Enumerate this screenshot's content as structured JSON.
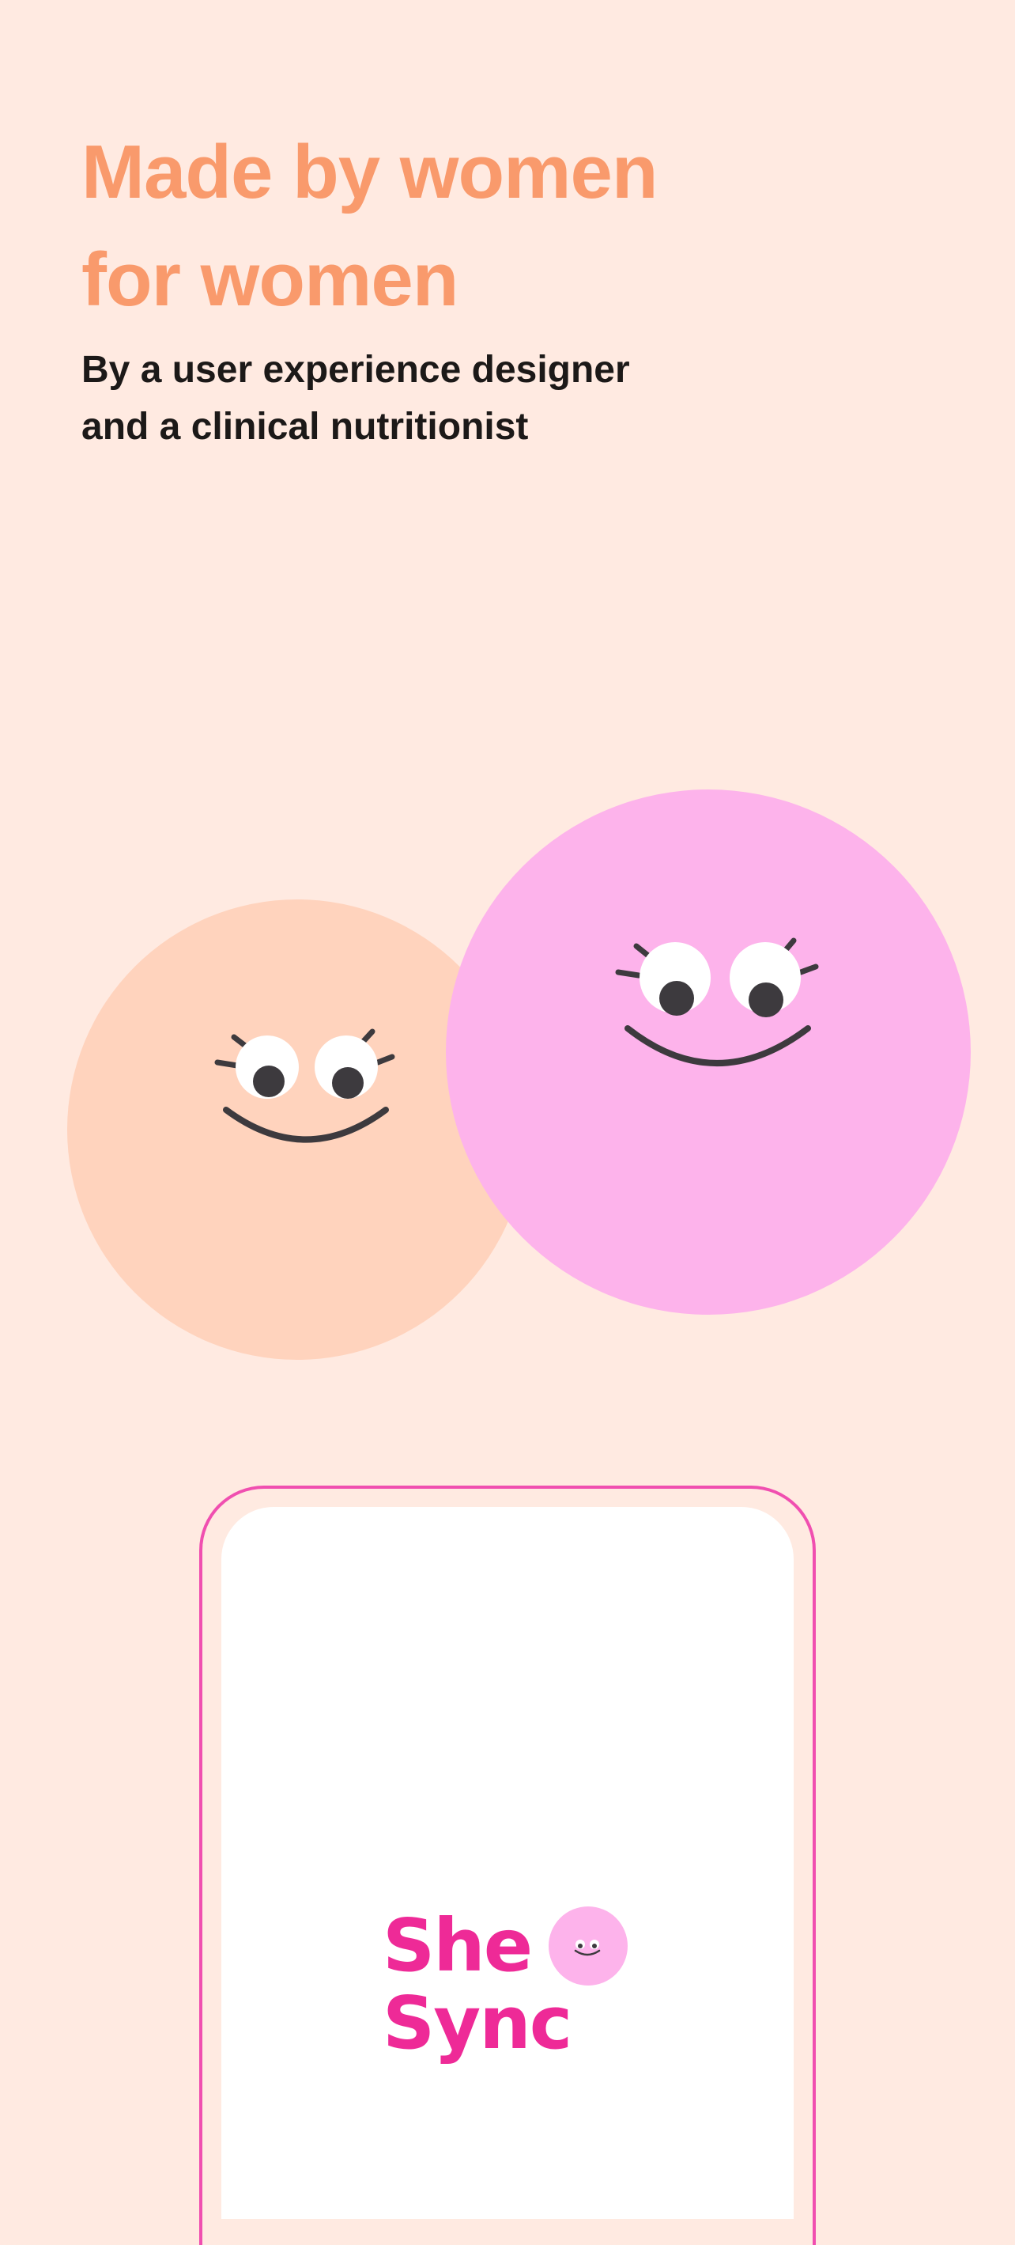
{
  "headline": {
    "line1": "Made by women",
    "line2": "for women"
  },
  "subheadline": {
    "line1": "By a user experience designer",
    "line2": "and a clinical nutritionist"
  },
  "illustration": {
    "faces": [
      {
        "name": "peach-face",
        "color": "#FFD3BD"
      },
      {
        "name": "pink-face",
        "color": "#FDB3EB"
      }
    ]
  },
  "app_logo": {
    "word1": "She",
    "word2": "Sync",
    "brand_color": "#EE2A97",
    "face_color": "#FDB3EB"
  },
  "colors": {
    "background": "#FFEAE1",
    "headline": "#F99A6C",
    "body_text": "#1C1918",
    "phone_outline": "#F04FB0"
  }
}
